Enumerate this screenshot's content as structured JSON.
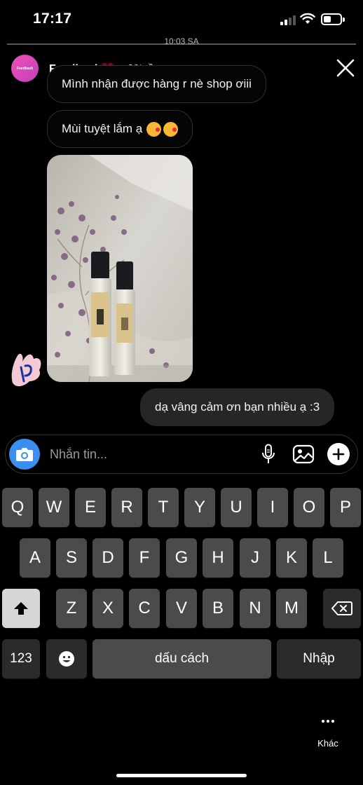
{
  "status": {
    "time": "17:17"
  },
  "story": {
    "timestamp": "10:03 SA"
  },
  "header": {
    "name": "Feedback💗",
    "age": "20tuần",
    "avatar_text": "Feedback"
  },
  "messages": [
    {
      "text": "Mình nhận được hàng r nè shop ơiii",
      "side": "incoming"
    },
    {
      "text": "Mùi tuyệt lắm ạ",
      "side": "incoming",
      "emoji": [
        "kissing-heart-emoji",
        "kissing-heart-emoji"
      ]
    },
    {
      "image": "two perfume bottles on patterned cloth",
      "side": "incoming"
    },
    {
      "text": "dạ vâng cảm ơn bạn nhiều ạ :3",
      "side": "outgoing"
    }
  ],
  "composer": {
    "placeholder": "Nhắn tin..."
  },
  "keyboard": {
    "row1": [
      "Q",
      "W",
      "E",
      "R",
      "T",
      "Y",
      "U",
      "I",
      "O",
      "P"
    ],
    "row2": [
      "A",
      "S",
      "D",
      "F",
      "G",
      "H",
      "J",
      "K",
      "L"
    ],
    "row3": [
      "Z",
      "X",
      "C",
      "V",
      "B",
      "N",
      "M"
    ],
    "numbers_label": "123",
    "space_label": "dấu cách",
    "return_label": "Nhập"
  },
  "more": {
    "label": "Khác"
  },
  "colors": {
    "accent": "#3a8ef0",
    "bubble_outgoing": "#262626",
    "avatar_gradient": "#f150b5"
  }
}
